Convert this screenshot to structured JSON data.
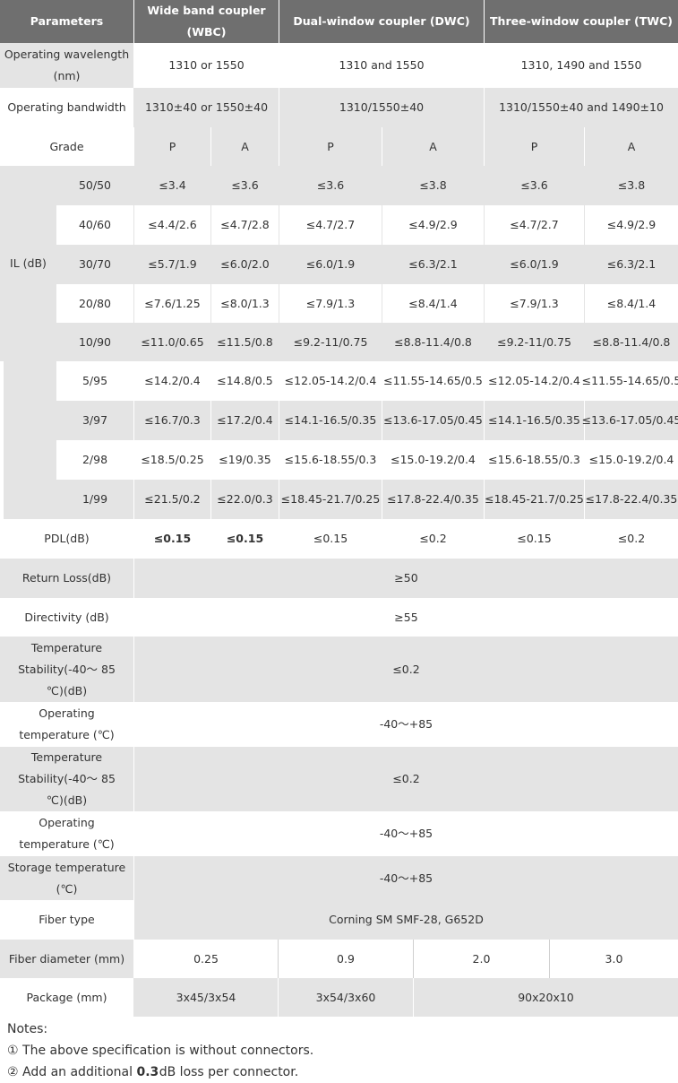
{
  "header": {
    "parameters": "Parameters",
    "wbc": "Wide band coupler (WBC)",
    "dwc": "Dual-window coupler (DWC)",
    "twc": "Three-window coupler (TWC)"
  },
  "operating_wavelength": {
    "label": "Operating wavelength (nm)",
    "wbc": "1310 or 1550",
    "dwc": "1310 and 1550",
    "twc": "1310, 1490 and 1550"
  },
  "operating_bandwidth": {
    "label": "Operating bandwidth",
    "wbc": "1310±40 or 1550±40",
    "dwc": "1310/1550±40",
    "twc": "1310/1550±40 and 1490±10"
  },
  "grade": {
    "label": "Grade",
    "values": [
      "P",
      "A",
      "P",
      "A",
      "P",
      "A"
    ]
  },
  "il": {
    "label": "IL (dB)",
    "rows": [
      {
        "ratio": "50/50",
        "values": [
          "≤3.4",
          "≤3.6",
          "≤3.6",
          "≤3.8",
          "≤3.6",
          "≤3.8"
        ]
      },
      {
        "ratio": "40/60",
        "values": [
          "≤4.4/2.6",
          "≤4.7/2.8",
          "≤4.7/2.7",
          "≤4.9/2.9",
          "≤4.7/2.7",
          "≤4.9/2.9"
        ]
      },
      {
        "ratio": "30/70",
        "values": [
          "≤5.7/1.9",
          "≤6.0/2.0",
          "≤6.0/1.9",
          "≤6.3/2.1",
          "≤6.0/1.9",
          "≤6.3/2.1"
        ]
      },
      {
        "ratio": "20/80",
        "values": [
          "≤7.6/1.25",
          "≤8.0/1.3",
          "≤7.9/1.3",
          "≤8.4/1.4",
          "≤7.9/1.3",
          "≤8.4/1.4"
        ]
      },
      {
        "ratio": "10/90",
        "values": [
          "≤11.0/0.65",
          "≤11.5/0.8",
          "≤9.2-11/0.75",
          "≤8.8-11.4/0.8",
          "≤9.2-11/0.75",
          "≤8.8-11.4/0.8"
        ]
      }
    ]
  },
  "il2": {
    "rows": [
      {
        "ratio": "5/95",
        "values": [
          "≤14.2/0.4",
          "≤14.8/0.5",
          "≤12.05-14.2/0.4",
          "≤11.55-14.65/0.5",
          "≤12.05-14.2/0.4",
          "≤11.55-14.65/0.5"
        ]
      },
      {
        "ratio": "3/97",
        "values": [
          "≤16.7/0.3",
          "≤17.2/0.4",
          "≤14.1-16.5/0.35",
          "≤13.6-17.05/0.45",
          "≤14.1-16.5/0.35",
          "≤13.6-17.05/0.45"
        ]
      },
      {
        "ratio": "2/98",
        "values": [
          "≤18.5/0.25",
          "≤19/0.35",
          "≤15.6-18.55/0.3",
          "≤15.0-19.2/0.4",
          "≤15.6-18.55/0.3",
          "≤15.0-19.2/0.4"
        ]
      },
      {
        "ratio": "1/99",
        "values": [
          "≤21.5/0.2",
          "≤22.0/0.3",
          "≤18.45-21.7/0.25",
          "≤17.8-22.4/0.35",
          "≤18.45-21.7/0.25",
          "≤17.8-22.4/0.35"
        ]
      }
    ]
  },
  "pdl": {
    "label": "PDL(dB)",
    "values": [
      "≤0.15",
      "≤0.15",
      "≤0.15",
      "≤0.2",
      "≤0.15",
      "≤0.2"
    ]
  },
  "return_loss": {
    "label": "Return Loss(dB)",
    "value": "≥50"
  },
  "directivity": {
    "label": "Directivity (dB)",
    "value": "≥55"
  },
  "temp_stability_1": {
    "label": "Temperature Stability(-40～ 85 ℃)(dB)",
    "value": "≤0.2"
  },
  "operating_temp_1": {
    "label": "Operating temperature (℃)",
    "value": "-40～+85"
  },
  "temp_stability_2": {
    "label": "Temperature Stability(-40～ 85 ℃)(dB)",
    "value": "≤0.2"
  },
  "operating_temp_2": {
    "label": "Operating temperature (℃)",
    "value": "-40～+85"
  },
  "storage_temp": {
    "label": "Storage temperature (℃)",
    "value": "-40～+85"
  },
  "fiber_type": {
    "label": "Fiber type",
    "value": "Corning SM SMF-28, G652D"
  },
  "fiber_diameter": {
    "label": "Fiber diameter (mm)",
    "values": [
      "0.25",
      "0.9",
      "2.0",
      "3.0"
    ]
  },
  "package": {
    "label": "Package (mm)",
    "wbc": "3x45/3x54",
    "dwc": "3x54/3x60",
    "twc": "90x20x10"
  },
  "notes": {
    "title": "Notes:",
    "note1_marker": "①",
    "note1": "The above specification is without connectors.",
    "note2_marker": "②",
    "note2_pre": "Add an additional",
    "note2_value": "0.3",
    "note2_post": "dB loss per connector."
  }
}
